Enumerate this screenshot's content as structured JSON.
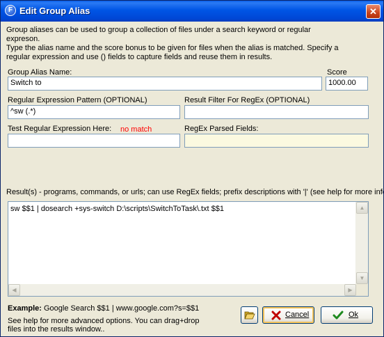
{
  "window": {
    "title": "Edit Group Alias",
    "close_glyph": "✕"
  },
  "description": {
    "lines": [
      "Group aliases can be used to group a collection of files under a search keyword or regular",
      "expreson.",
      "Type the alias name and the score bonus to be given for files when the alias is matched.  Specify a",
      "regular expression and use () fields to capture fields and reuse them in results."
    ]
  },
  "alias": {
    "label": "Group Alias Name:",
    "value": "Switch to"
  },
  "score": {
    "label": "Score",
    "value": "1000.00"
  },
  "regex": {
    "label": "Regular Expression Pattern (OPTIONAL)",
    "value": "^sw (.*)"
  },
  "filter": {
    "label": "Result Filter For RegEx (OPTIONAL)",
    "value": ""
  },
  "test": {
    "label": "Test Regular Expression Here:",
    "status": "no match",
    "status_color": "#ff0000",
    "value": ""
  },
  "parsed": {
    "label": "RegEx Parsed Fields:",
    "value": ""
  },
  "results": {
    "label": "Result(s) - programs, commands, or urls; can use RegEx fields; prefix descriptions with '|' (see help for more info)",
    "value": "sw $$1 | dosearch +sys-switch D:\\scripts\\SwitchToTask\\.txt $$1"
  },
  "example": {
    "label": "Example:",
    "text": "Google Search $$1 | www.google.com?s=$$1"
  },
  "help_text": {
    "line1": "See help for more advanced options.  You can drag+drop",
    "line2": "files into the results window.."
  },
  "buttons": {
    "open_icon": "folder-open-icon",
    "cancel": {
      "label": "Cancel",
      "icon": "x-icon"
    },
    "ok": {
      "label": "Ok",
      "icon": "checkmark-icon"
    }
  },
  "colors": {
    "title_bar": "#0055e5",
    "dialog_bg": "#ece9d8",
    "parsed_bg": "#fbf9e0",
    "cancel_red": "#c00000",
    "ok_green": "#1f8a1f"
  }
}
